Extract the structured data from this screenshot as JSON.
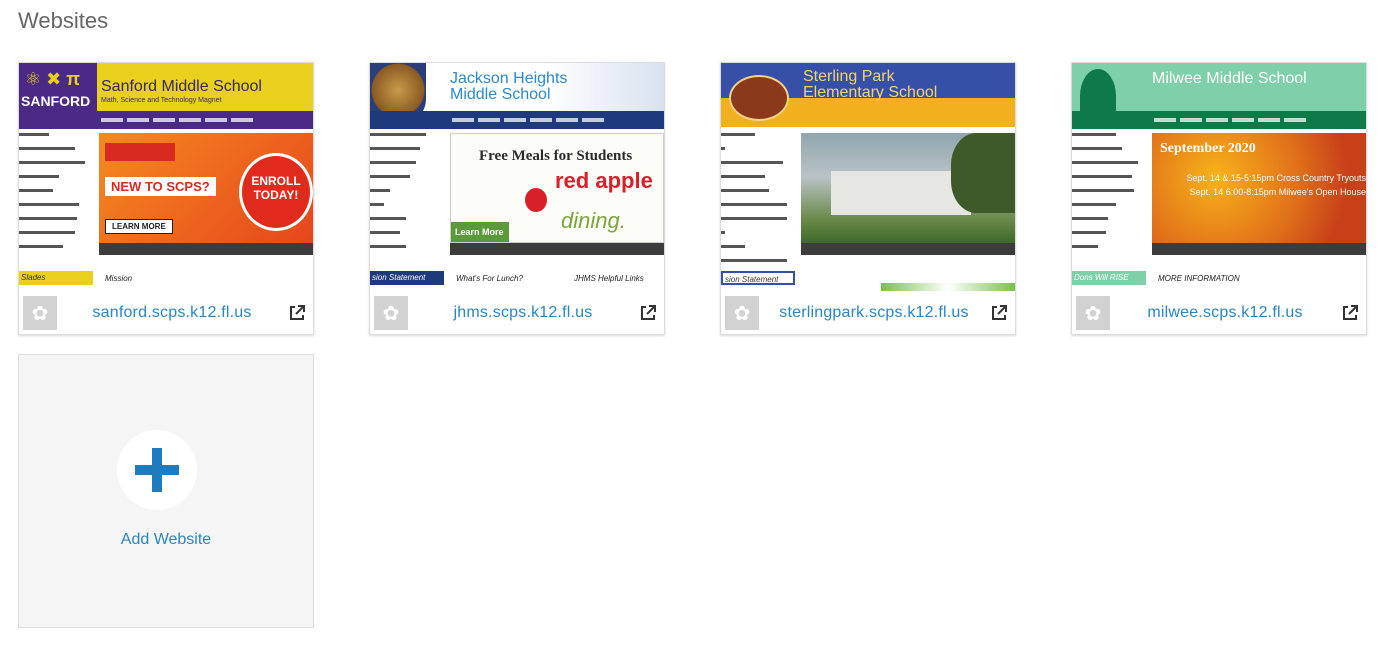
{
  "page": {
    "title": "Websites"
  },
  "colors": {
    "link": "#2a86c3",
    "icon_bg": "#d2d2d2",
    "add_bg": "#f5f5f5"
  },
  "websites": [
    {
      "url": "sanford.scps.k12.fl.us",
      "preview": {
        "school_name": "Sanford Middle School",
        "tagline": "Math, Science and Technology Magnet",
        "logo_text": "SANFORD",
        "hero_lines": [
          "NEW TO SCPS?",
          "ENROLL TODAY!",
          "LEARN MORE"
        ],
        "bottom_tabs": [
          "Mission"
        ],
        "bottom_left": "Slades"
      }
    },
    {
      "url": "jhms.scps.k12.fl.us",
      "preview": {
        "school_name": "Jackson Heights Middle School",
        "hero_lines": [
          "Free Meals for Students",
          "red apple",
          "dining.",
          "Learn More"
        ],
        "bottom_tabs": [
          "What's For Lunch?",
          "JHMS Helpful Links"
        ],
        "bottom_left": "sion Statement"
      }
    },
    {
      "url": "sterlingpark.scps.k12.fl.us",
      "preview": {
        "school_name": "Sterling Park Elementary School",
        "bottom_left": "sion Statement"
      }
    },
    {
      "url": "milwee.scps.k12.fl.us",
      "preview": {
        "school_name": "Milwee Middle School",
        "hero_lines": [
          "September 2020",
          "Sept. 14 & 15-5:15pm Cross Country Tryouts",
          "Sept. 14 6:00-8:15pm Milwee's Open House"
        ],
        "bottom_tabs": [
          "MORE INFORMATION"
        ],
        "bottom_left": "Dons Will RISE"
      }
    }
  ],
  "add": {
    "label": "Add Website"
  },
  "icons": {
    "site": "flower-icon",
    "external": "external-link-icon",
    "add": "plus-icon"
  }
}
